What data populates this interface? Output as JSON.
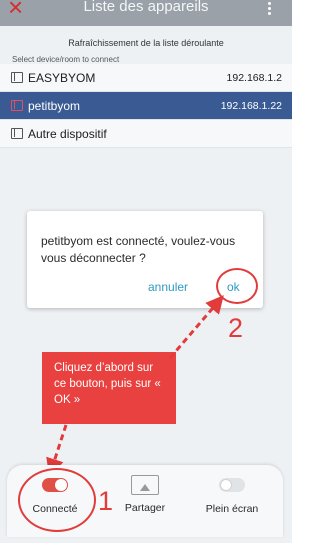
{
  "header": {
    "title": "Liste des appareils",
    "close_icon": "×"
  },
  "refresh_label": "Rafraîchissement de la liste déroulante",
  "select_label": "Select device/room to connect",
  "devices": [
    {
      "name": "EASYBYOM",
      "ip": "192.168.1.2",
      "selected": false
    },
    {
      "name": "petitbyom",
      "ip": "192.168.1.22",
      "selected": true
    },
    {
      "name": "Autre dispositif",
      "ip": "",
      "selected": false
    }
  ],
  "dialog": {
    "message": "petitbyom est connecté, voulez-vous vous déconnecter ?",
    "cancel_label": "annuler",
    "ok_label": "ok"
  },
  "annotations": {
    "callout_text": "Cliquez d’abord sur ce bouton, puis sur « OK »",
    "step1": "1",
    "step2": "2",
    "color": "#e23b3b"
  },
  "bottom_bar": {
    "connected_label": "Connecté",
    "share_label": "Partager",
    "fullscreen_label": "Plein écran"
  }
}
